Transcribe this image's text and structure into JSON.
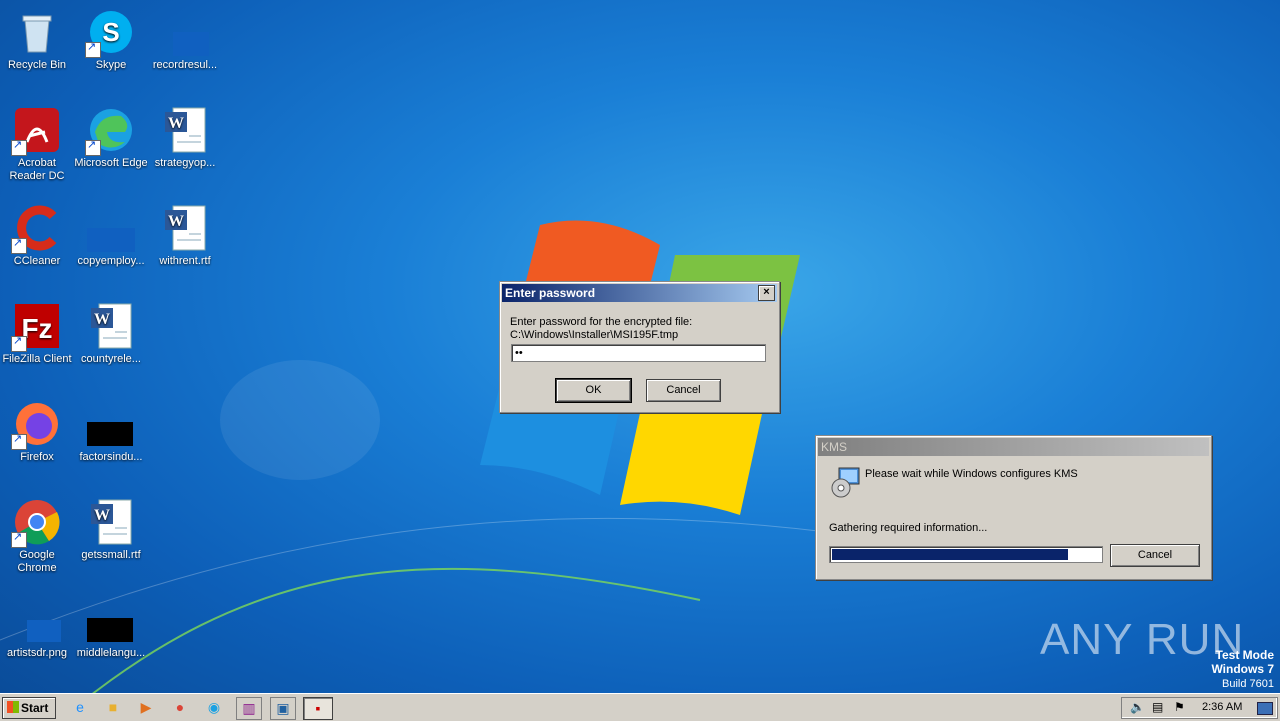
{
  "desktop": {
    "icons": [
      {
        "label": "Recycle Bin"
      },
      {
        "label": "Skype"
      },
      {
        "label": "recordresul..."
      },
      {
        "label": "Acrobat Reader DC"
      },
      {
        "label": "Microsoft Edge"
      },
      {
        "label": "strategyop..."
      },
      {
        "label": "CCleaner"
      },
      {
        "label": "copyemploy..."
      },
      {
        "label": "withrent.rtf"
      },
      {
        "label": "FileZilla Client"
      },
      {
        "label": "countyrele..."
      },
      {
        "label": "Firefox"
      },
      {
        "label": "factorsindu..."
      },
      {
        "label": "Google Chrome"
      },
      {
        "label": "getssmall.rtf"
      },
      {
        "label": "artistsdr.png"
      },
      {
        "label": "middlelangu..."
      }
    ]
  },
  "password_dialog": {
    "title": "Enter password",
    "close": "×",
    "prompt": "Enter password for the encrypted file:",
    "path": "C:\\Windows\\Installer\\MSI195F.tmp",
    "value": "••",
    "ok_label": "OK",
    "cancel_label": "Cancel"
  },
  "kms_dialog": {
    "title": "KMS",
    "message": "Please wait while Windows configures KMS",
    "status": "Gathering required information...",
    "progress": 0.88,
    "cancel_label": "Cancel"
  },
  "watermark": {
    "brand": "ANY RUN",
    "mode": "Test Mode",
    "os": "Windows 7",
    "build": "Build 7601"
  },
  "taskbar": {
    "start_label": "Start",
    "clock": "2:36 AM"
  },
  "colors": {
    "titlebar_active": "#0a246a",
    "progress_fill": "#0a246a",
    "desktop_bg": "#1a7fd6"
  }
}
